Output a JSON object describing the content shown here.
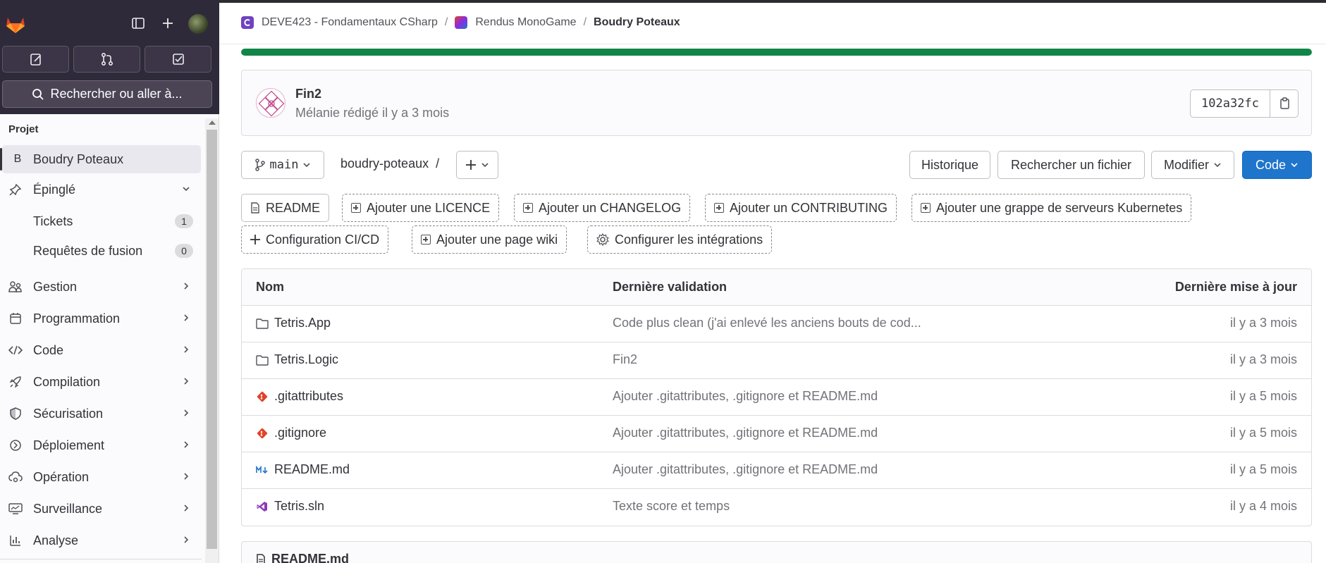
{
  "sidebar": {
    "search_label": "Rechercher ou aller à...",
    "section_title": "Projet",
    "project_initial": "B",
    "project_name": "Boudry Poteaux",
    "items": [
      {
        "label": "Épinglé"
      },
      {
        "label": "Tickets",
        "count": "1"
      },
      {
        "label": "Requêtes de fusion",
        "count": "0"
      },
      {
        "label": "Gestion"
      },
      {
        "label": "Programmation"
      },
      {
        "label": "Code"
      },
      {
        "label": "Compilation"
      },
      {
        "label": "Sécurisation"
      },
      {
        "label": "Déploiement"
      },
      {
        "label": "Opération"
      },
      {
        "label": "Surveillance"
      },
      {
        "label": "Analyse"
      }
    ]
  },
  "breadcrumb": {
    "group": "DEVE423 - Fondamentaux CSharp",
    "subgroup": "Rendus MonoGame",
    "project": "Boudry Poteaux",
    "separator": "/"
  },
  "pipeline_progress": 1.0,
  "commit": {
    "title": "Fin2",
    "meta": "Mélanie rédigé il y a 3 mois",
    "sha": "102a32fc"
  },
  "toolbar": {
    "branch": "main",
    "path": "boudry-poteaux",
    "path_sep": "/",
    "history": "Historique",
    "find_file": "Rechercher un fichier",
    "modify": "Modifier",
    "code": "Code"
  },
  "quick_actions": [
    "README",
    "Ajouter une LICENCE",
    "Ajouter un CHANGELOG",
    "Ajouter un CONTRIBUTING",
    "Ajouter une grappe de serveurs Kubernetes",
    "Configuration CI/CD",
    "Ajouter une page wiki",
    "Configurer les intégrations"
  ],
  "table": {
    "headers": {
      "name": "Nom",
      "last_commit": "Dernière validation",
      "last_update": "Dernière mise à jour"
    },
    "rows": [
      {
        "name": "Tetris.App",
        "icon": "folder-icon",
        "commit": "Code plus clean (j'ai enlevé les anciens bouts de cod...",
        "date": "il y a 3 mois"
      },
      {
        "name": "Tetris.Logic",
        "icon": "folder-icon",
        "commit": "Fin2",
        "date": "il y a 3 mois"
      },
      {
        "name": ".gitattributes",
        "icon": "git-icon",
        "commit": "Ajouter .gitattributes, .gitignore et README.md",
        "date": "il y a 5 mois"
      },
      {
        "name": ".gitignore",
        "icon": "git-icon",
        "commit": "Ajouter .gitattributes, .gitignore et README.md",
        "date": "il y a 5 mois"
      },
      {
        "name": "README.md",
        "icon": "markdown-icon",
        "commit": "Ajouter .gitattributes, .gitignore et README.md",
        "date": "il y a 5 mois"
      },
      {
        "name": "Tetris.sln",
        "icon": "visual-studio-icon",
        "commit": "Texte score et temps",
        "date": "il y a 4 mois"
      }
    ]
  },
  "readme_title": "README.md",
  "colors": {
    "primary": "#1f75cb",
    "success": "#108548",
    "sidebar_dark": "#2f2a3a"
  }
}
